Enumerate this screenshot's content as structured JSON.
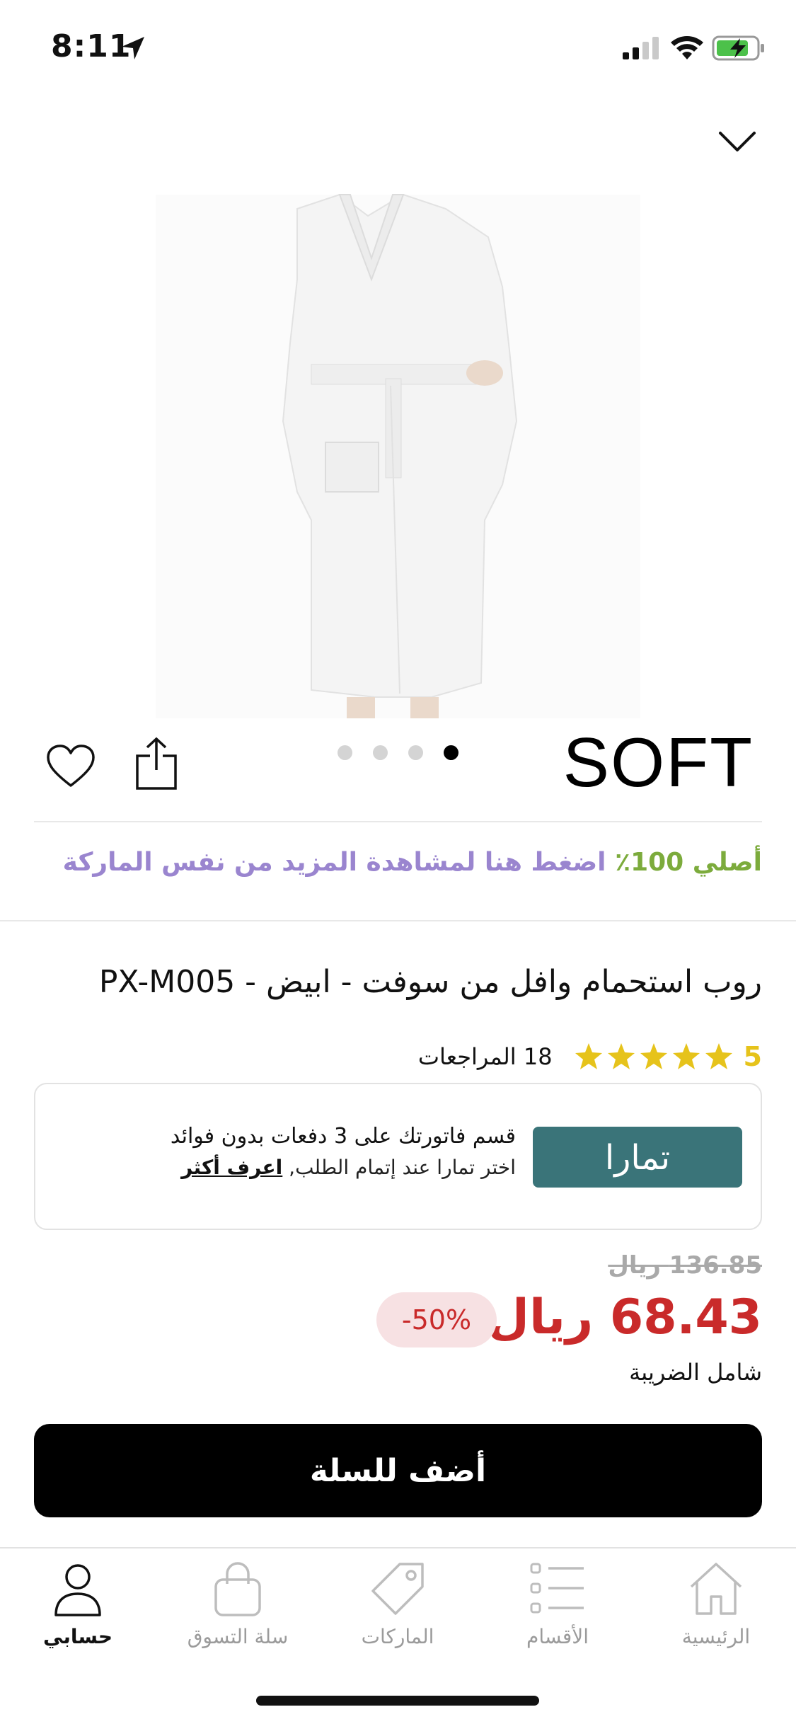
{
  "status_bar": {
    "time": "8:11",
    "icons": [
      "location-arrow-icon",
      "signal-icon",
      "wifi-icon",
      "battery-charging-icon"
    ]
  },
  "gallery": {
    "image_description_icon": "white-bathrobe-image",
    "dot_count": 4,
    "active_dot": 4
  },
  "product": {
    "brand": "SOFT",
    "brand_promo": {
      "original_label": "أصلي 100٪",
      "link_text": "اضغط هنا لمشاهدة المزيد من نفس الماركة"
    },
    "title": "روب استحمام وافل من سوفت - ابيض - PX-M005",
    "rating": "5",
    "stars": 5,
    "reviews_label": "18 المراجعات"
  },
  "tamara": {
    "logo_text": "تمارا",
    "headline": "قسم فاتورتك على 3 دفعات بدون فوائد",
    "subline": "اختر تمارا عند إتمام الطلب, ",
    "learn_more": "اعرف أكثر"
  },
  "pricing": {
    "old_price": "136.85 ريال",
    "current_price": "68.43 ريال",
    "discount": "-50%",
    "tax_note": "شامل الضريبة"
  },
  "actions": {
    "add_to_cart": "أضف للسلة"
  },
  "tab_bar": {
    "items": [
      {
        "label": "الرئيسية",
        "icon": "home-icon"
      },
      {
        "label": "الأقسام",
        "icon": "list-icon"
      },
      {
        "label": "الماركات",
        "icon": "tag-icon"
      },
      {
        "label": "سلة التسوق",
        "icon": "shopping-bag-icon"
      },
      {
        "label": "حسابي",
        "icon": "user-icon"
      }
    ],
    "active": "حسابي"
  },
  "colors": {
    "accent_green": "#7cab3c",
    "accent_purple": "#9a85cf",
    "price_red": "#c92a2a",
    "tamara_teal": "#3a7479",
    "star_gold": "#e6c31b"
  }
}
